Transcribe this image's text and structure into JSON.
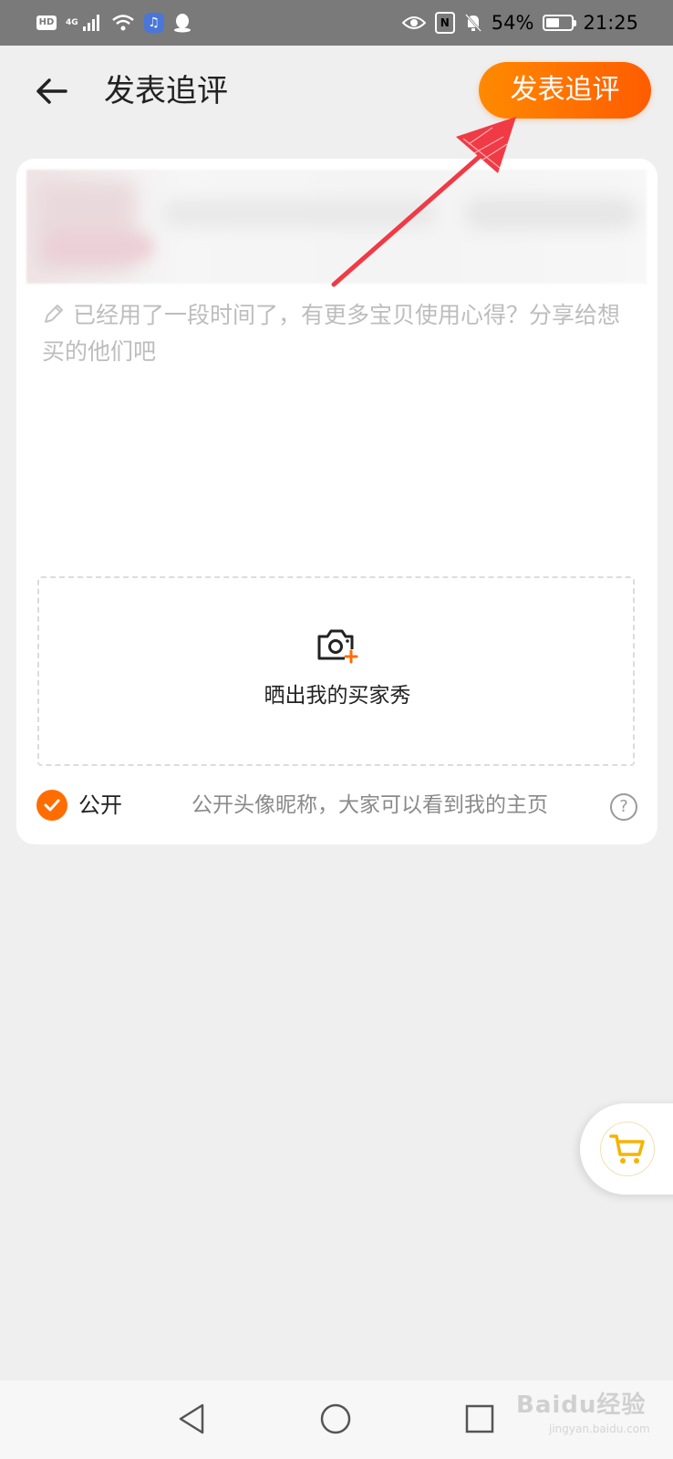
{
  "status_bar": {
    "hd": "HD",
    "network": "4G",
    "battery_percent": "54%",
    "battery_level": 0.54,
    "time": "21:25",
    "icons": [
      "hd-icon",
      "signal-icon",
      "wifi-icon",
      "music-app-icon",
      "qq-icon",
      "eye-icon",
      "nfc-icon",
      "mute-bell-icon",
      "battery-icon"
    ]
  },
  "header": {
    "title": "发表追评",
    "submit_label": "发表追评",
    "back_icon": "back-arrow-icon"
  },
  "review": {
    "placeholder": "已经用了一段时间了，有更多宝贝使用心得？分享给想买的他们吧",
    "photo_label": "晒出我的买家秀",
    "public_label": "公开",
    "public_checked": true,
    "public_desc": "公开头像昵称，大家可以看到我的主页",
    "help_symbol": "?"
  },
  "watermark": {
    "text": "Baidu经验",
    "sub": "jingyan.baidu.com"
  },
  "colors": {
    "accent": "#ff6d00",
    "submit_gradient_start": "#ff8a00",
    "submit_gradient_end": "#ff5c00",
    "annotation_arrow": "#f03a45",
    "cart": "#f5b400"
  }
}
